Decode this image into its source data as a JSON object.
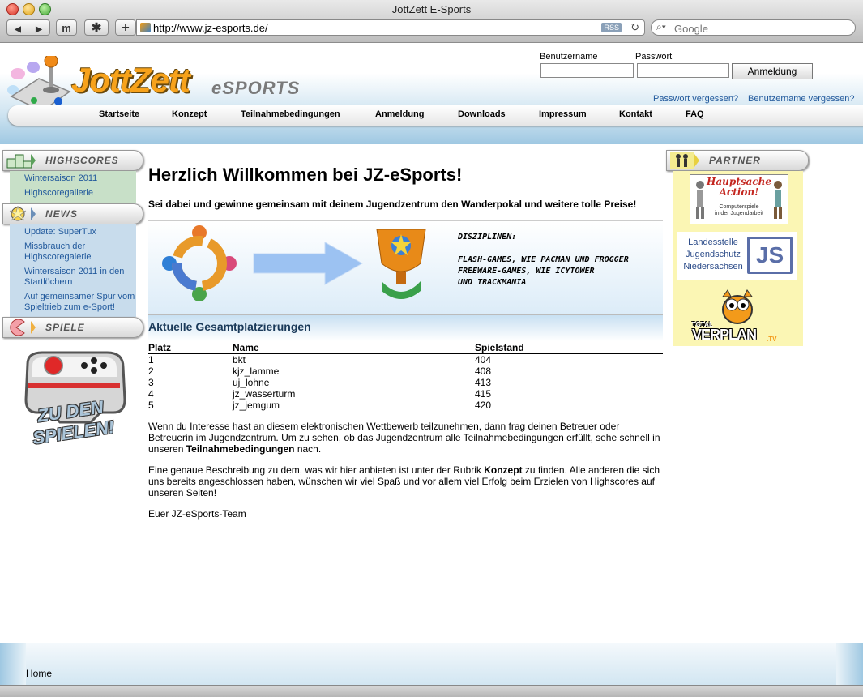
{
  "browser": {
    "window_title": "JottZett E-Sports",
    "url": "http://www.jz-esports.de/",
    "rss_label": "RSS",
    "search_placeholder": "Google",
    "m_label": "m",
    "star_label": "✱",
    "plus_label": "+"
  },
  "header": {
    "logo_main": "JottZett",
    "logo_sub": "eSPORTS",
    "username_label": "Benutzername",
    "password_label": "Passwort",
    "login_button": "Anmeldung",
    "forgot_password": "Passwort vergessen?",
    "forgot_username": "Benutzername vergessen?"
  },
  "nav": [
    "Startseite",
    "Konzept",
    "Teilnahmebedingungen",
    "Anmeldung",
    "Downloads",
    "Impressum",
    "Kontakt",
    "FAQ"
  ],
  "sidebar": {
    "highscores_title": "HIGHSCORES",
    "highscores_links": [
      "Wintersaison 2011",
      "Highscoregallerie"
    ],
    "news_title": "NEWS",
    "news_links": [
      "Update: SuperTux",
      "Missbrauch der Highscoregalerie",
      "Wintersaison 2011 in den Startlöchern",
      "Auf gemeinsamer Spur vom Spieltrieb zum e-Sport!"
    ],
    "spiele_title": "SPIELE",
    "games_caption_1": "ZU DEN",
    "games_caption_2": "SPIELEN!"
  },
  "main": {
    "title": "Herzlich Willkommen bei JZ-eSports!",
    "subtitle": "Sei dabei und gewinne gemeinsam mit deinem Jugendzentrum den Wanderpokal und weitere tolle Preise!",
    "disciplines_title": "DISZIPLINEN:",
    "disciplines_lines": [
      "FLASH-GAMES, WIE PACMAN UND FROGGER",
      "FREEWARE-GAMES, WIE ICYTOWER",
      "UND TRACKMANIA"
    ],
    "ranking_title": "Aktuelle Gesamtplatzierungen",
    "ranking_headers": [
      "Platz",
      "Name",
      "Spielstand"
    ],
    "ranking_rows": [
      [
        "1",
        "bkt",
        "404"
      ],
      [
        "2",
        "kjz_lamme",
        "408"
      ],
      [
        "3",
        "uj_lohne",
        "413"
      ],
      [
        "4",
        "jz_wasserturm",
        "415"
      ],
      [
        "5",
        "jz_jemgum",
        "420"
      ]
    ],
    "para1_a": "Wenn du Interesse hast an diesem elektronischen Wettbewerb teilzunehmen, dann frag deinen Betreuer oder Betreuerin im Jugendzentrum. Um zu sehen, ob das Jugendzentrum alle Teilnahmebedingungen erfüllt, sehe schnell in unseren ",
    "para1_link": "Teilnahmebedingungen",
    "para1_b": " nach.",
    "para2_a": "Eine genaue Beschreibung zu dem, was wir hier anbieten ist unter der Rubrik ",
    "para2_link": "Konzept",
    "para2_b": " zu finden. Alle anderen die sich uns bereits angeschlossen haben, wünschen wir viel Spaß und vor allem viel Erfolg beim Erzielen von Highscores auf unseren Seiten!",
    "signature": "Euer JZ-eSports-Team"
  },
  "partner": {
    "title": "PARTNER",
    "hauptsache_1": "Hauptsache",
    "hauptsache_2": "Action!",
    "hauptsache_sub_1": "Computerspiele",
    "hauptsache_sub_2": "in der Jugendarbeit",
    "lj_lines": [
      "Landesstelle",
      "Jugendschutz",
      "Niedersachsen"
    ],
    "lj_logo": "JS",
    "verplan_top": "TOTAL",
    "verplan_main": "VERPLAN",
    "verplan_suffix": ".TV"
  },
  "footer": {
    "home": "Home"
  }
}
